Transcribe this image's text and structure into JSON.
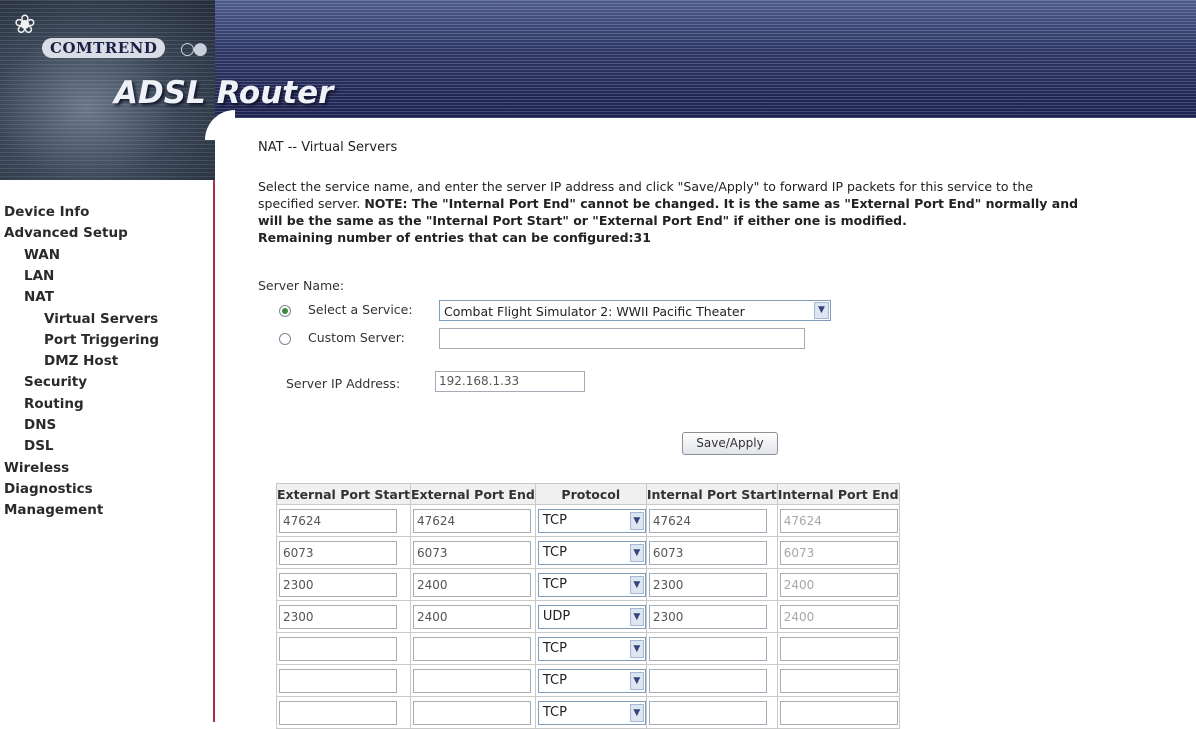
{
  "banner": {
    "brand": "COMTREND",
    "product": "ADSL Router"
  },
  "nav": [
    {
      "label": "Device Info",
      "level": 0
    },
    {
      "label": "Advanced Setup",
      "level": 0
    },
    {
      "label": "WAN",
      "level": 1
    },
    {
      "label": "LAN",
      "level": 1
    },
    {
      "label": "NAT",
      "level": 1
    },
    {
      "label": "Virtual Servers",
      "level": 2
    },
    {
      "label": "Port Triggering",
      "level": 2
    },
    {
      "label": "DMZ Host",
      "level": 2
    },
    {
      "label": "Security",
      "level": 1
    },
    {
      "label": "Routing",
      "level": 1
    },
    {
      "label": "DNS",
      "level": 1
    },
    {
      "label": "DSL",
      "level": 1
    },
    {
      "label": "Wireless",
      "level": 0
    },
    {
      "label": "Diagnostics",
      "level": 0
    },
    {
      "label": "Management",
      "level": 0
    }
  ],
  "page": {
    "title": "NAT -- Virtual Servers",
    "desc_line1": "Select the service name, and enter the server IP address and click \"Save/Apply\" to forward IP packets for this service to the",
    "desc_line2_normal": "specified server. ",
    "desc_line2_bold": "NOTE: The \"Internal Port End\" cannot be changed. It is the same as \"External Port End\" normally and",
    "desc_line3": "will be the same as the \"Internal Port Start\" or \"External Port End\" if either one is modified.",
    "desc_line4": "Remaining number of entries that can be configured:31"
  },
  "form": {
    "server_name_label": "Server Name:",
    "select_service_label": "Select a Service:",
    "select_service_value": "Combat Flight Simulator 2: WWII Pacific Theater",
    "select_service_checked": true,
    "custom_server_label": "Custom Server:",
    "custom_server_value": "",
    "server_ip_label": "Server IP Address:",
    "server_ip_value": "192.168.1.33",
    "save_apply_label": "Save/Apply"
  },
  "table": {
    "headers": [
      "External Port Start",
      "External Port End",
      "Protocol",
      "Internal Port Start",
      "Internal Port End"
    ],
    "rows": [
      {
        "ext_start": "47624",
        "ext_end": "47624",
        "protocol": "TCP",
        "int_start": "47624",
        "int_end": "47624"
      },
      {
        "ext_start": "6073",
        "ext_end": "6073",
        "protocol": "TCP",
        "int_start": "6073",
        "int_end": "6073"
      },
      {
        "ext_start": "2300",
        "ext_end": "2400",
        "protocol": "TCP",
        "int_start": "2300",
        "int_end": "2400"
      },
      {
        "ext_start": "2300",
        "ext_end": "2400",
        "protocol": "UDP",
        "int_start": "2300",
        "int_end": "2400"
      },
      {
        "ext_start": "",
        "ext_end": "",
        "protocol": "TCP",
        "int_start": "",
        "int_end": ""
      },
      {
        "ext_start": "",
        "ext_end": "",
        "protocol": "TCP",
        "int_start": "",
        "int_end": ""
      },
      {
        "ext_start": "",
        "ext_end": "",
        "protocol": "TCP",
        "int_start": "",
        "int_end": ""
      }
    ]
  },
  "colors": {
    "banner_dark": "#1d2250",
    "sidebar_border": "#a3314a",
    "radio_selected": "#3a8a3a"
  },
  "icons": {
    "logo": "flower-logo-icon",
    "dropdown": "chevron-down-icon",
    "radio": "radio-button-icon"
  }
}
